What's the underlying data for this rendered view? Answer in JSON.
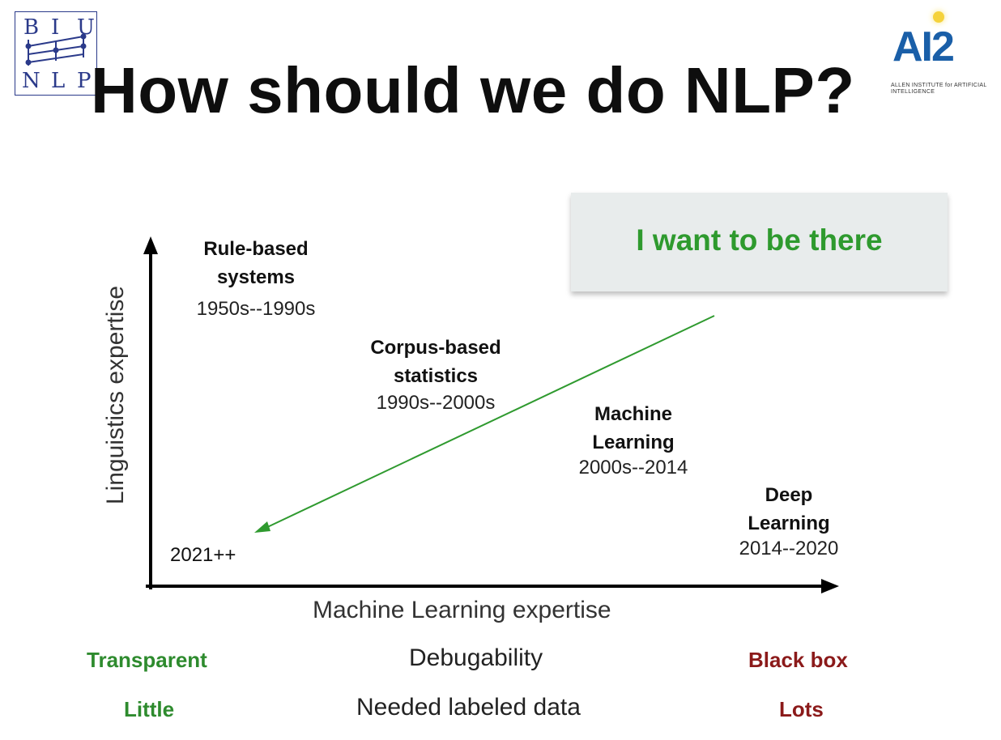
{
  "header": {
    "title": "How should we do NLP?",
    "logo_left_letters": [
      "B",
      "I",
      "U",
      "N",
      "L",
      "P"
    ],
    "logo_right_main": "AI2",
    "logo_right_sub": "ALLEN INSTITUTE for ARTIFICIAL INTELLIGENCE"
  },
  "callout": {
    "text": "I want to be there",
    "color": "#2e9a2e"
  },
  "axes": {
    "y_label": "Linguistics expertise",
    "x_label": "Machine Learning expertise"
  },
  "eras": [
    {
      "name_lines": [
        "Rule-based",
        "systems"
      ],
      "years": "1950s--1990s"
    },
    {
      "name_lines": [
        "Corpus-based",
        "statistics"
      ],
      "years": "1990s--2000s"
    },
    {
      "name_lines": [
        "Machine",
        "Learning"
      ],
      "years": "2000s--2014"
    },
    {
      "name_lines": [
        "Deep",
        "Learning"
      ],
      "years": "2014--2020"
    }
  ],
  "future_label": "2021++",
  "arrow": {
    "color": "#2f9a2f",
    "direction": "from callout toward 2021++"
  },
  "rows": [
    {
      "left": "Transparent",
      "center": "Debugability",
      "right": "Black box"
    },
    {
      "left": "Little",
      "center": "Needed labeled data",
      "right": "Lots"
    }
  ],
  "colors": {
    "good": "#2e8b2e",
    "bad": "#8b1a1a"
  }
}
